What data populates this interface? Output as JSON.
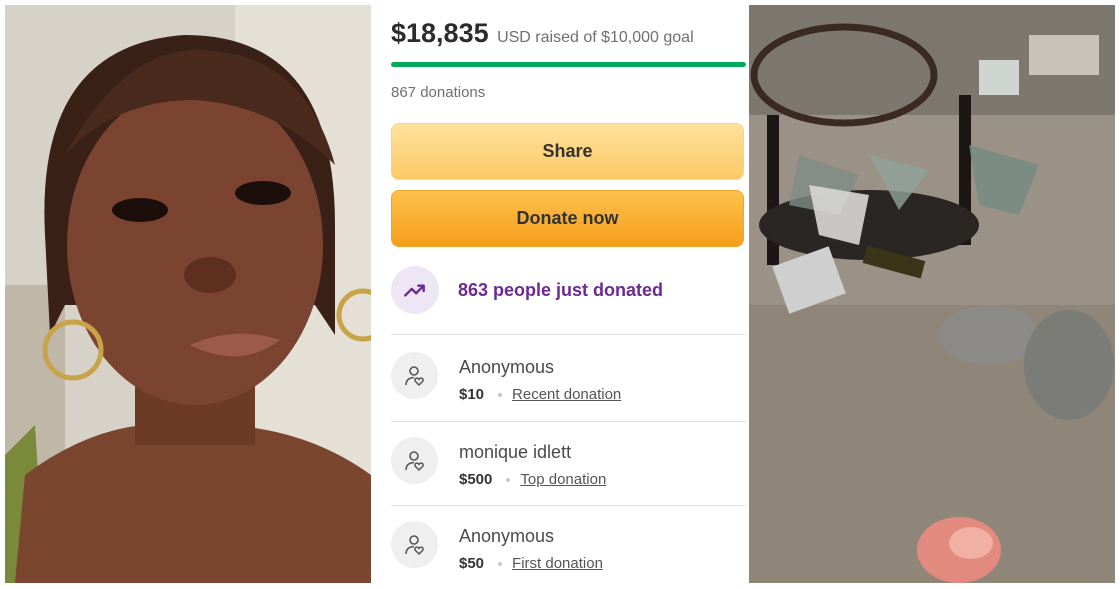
{
  "campaign": {
    "raised_amount": "$18,835",
    "raised_text": "USD raised of $10,000 goal",
    "progress_fraction": 1.0,
    "donation_count": "867 donations",
    "share_label": "Share",
    "donate_label": "Donate now",
    "trend_text": "863 people just donated"
  },
  "donations": [
    {
      "name": "Anonymous",
      "amount": "$10",
      "tag": "Recent donation"
    },
    {
      "name": "monique idlett",
      "amount": "$500",
      "tag": "Top donation"
    },
    {
      "name": "Anonymous",
      "amount": "$50",
      "tag": "First donation"
    }
  ],
  "colors": {
    "progress": "#02a95c",
    "share_button": "#fbc966",
    "donate_button": "#f69e1c",
    "trend_text": "#6b2a94",
    "trend_circle": "#efe6f5"
  },
  "icons": {
    "trend": "trending-up-icon",
    "donor": "person-heart-icon"
  }
}
